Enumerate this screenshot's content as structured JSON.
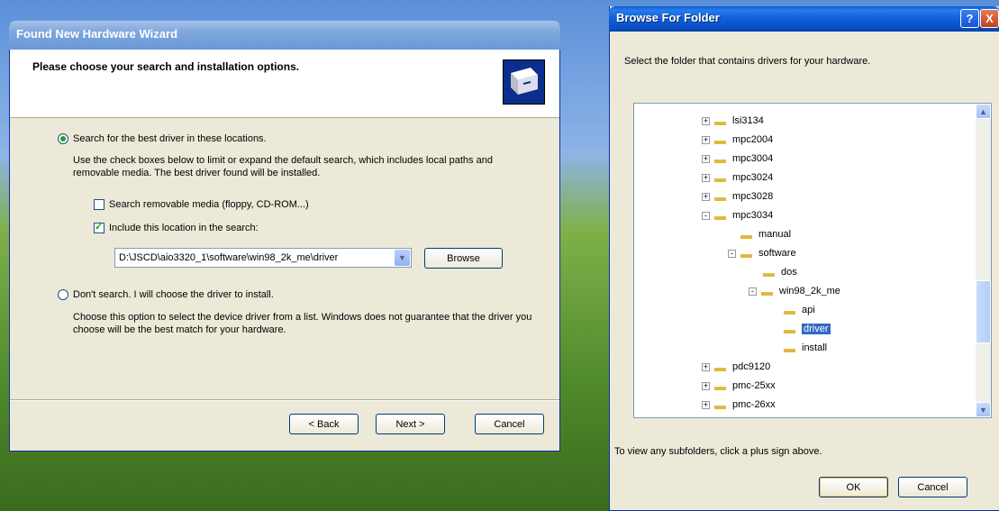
{
  "wizard": {
    "title": "Found New Hardware Wizard",
    "heading": "Please choose your search and installation options.",
    "opt_search_label": "Search for the best driver in these locations.",
    "opt_search_desc": "Use the check boxes below to limit or expand the default search, which includes local paths and removable media. The best driver found will be installed.",
    "chk_removable_label": "Search removable media (floppy, CD-ROM...)",
    "chk_include_label": "Include this location in the search:",
    "location_value": "D:\\JSCD\\aio3320_1\\software\\win98_2k_me\\driver",
    "browse_label": "Browse",
    "opt_dont_label": "Don't search. I will choose the driver to install.",
    "opt_dont_desc": "Choose this option to select the device driver from a list.  Windows does not guarantee that the driver you choose will be the best match for your hardware.",
    "back_label": "< Back",
    "next_label": "Next >",
    "cancel_label": "Cancel"
  },
  "browse": {
    "title": "Browse For Folder",
    "help_glyph": "?",
    "close_glyph": "X",
    "instruction": "Select the folder that contains drivers for your hardware.",
    "footer": "To view any subfolders, click a plus sign above.",
    "ok_label": "OK",
    "cancel_label": "Cancel",
    "tree": [
      {
        "label": "lsi3134",
        "expander": "+"
      },
      {
        "label": "mpc2004",
        "expander": "+"
      },
      {
        "label": "mpc3004",
        "expander": "+"
      },
      {
        "label": "mpc3024",
        "expander": "+"
      },
      {
        "label": "mpc3028",
        "expander": "+"
      },
      {
        "label": "mpc3034",
        "expander": "-"
      },
      {
        "label": "manual",
        "expander": ""
      },
      {
        "label": "software",
        "expander": "-"
      },
      {
        "label": "dos",
        "expander": ""
      },
      {
        "label": "win98_2k_me",
        "expander": "-"
      },
      {
        "label": "api",
        "expander": ""
      },
      {
        "label": "driver",
        "expander": "",
        "selected": true
      },
      {
        "label": "install",
        "expander": ""
      },
      {
        "label": "pdc9120",
        "expander": "+"
      },
      {
        "label": "pmc-25xx",
        "expander": "+"
      },
      {
        "label": "pmc-26xx",
        "expander": "+"
      }
    ]
  }
}
